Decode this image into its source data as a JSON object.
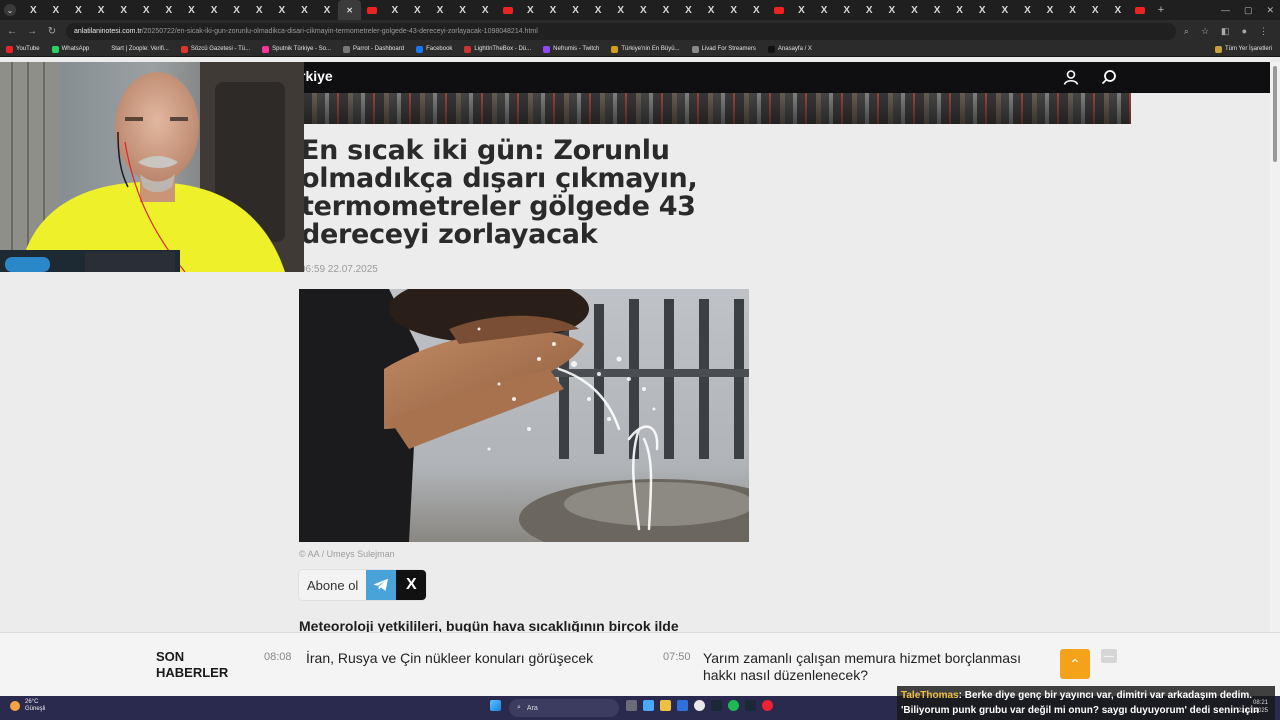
{
  "browser": {
    "tab_count": 50,
    "active_tab_index": 14,
    "youtube_tab_indices": [
      15,
      21,
      33,
      49,
      50,
      51
    ],
    "tab_close_glyph": "✕",
    "x_tab_glyph": "X",
    "newtab_glyph": "+",
    "url_host": "anlatilaninotesi.com.tr",
    "url_path": "/20250722/en-sicak-iki-gun-zorunlu-olmadikca-disari-cikmayin-termometreler-golgede-43-dereceyi-zorlayacak-1098048214.html",
    "bookmarks": [
      {
        "label": "YouTube",
        "color": "#e22"
      },
      {
        "label": "WhatsApp",
        "color": "#25d366"
      },
      {
        "label": "Start | Zoople: Verifi...",
        "color": "#2b2b2b"
      },
      {
        "label": "Sözcü Gazetesi - Tü...",
        "color": "#d33"
      },
      {
        "label": "Sputnik Türkiye - So...",
        "color": "#f39"
      },
      {
        "label": "Parrot - Dashboard",
        "color": "#777"
      },
      {
        "label": "Facebook",
        "color": "#1877f2"
      },
      {
        "label": "LightInTheBox - Dü...",
        "color": "#c33"
      },
      {
        "label": "Nefrumis - Twitch",
        "color": "#9146ff"
      },
      {
        "label": "Türkiye'nin En Büyü...",
        "color": "#d4a017"
      },
      {
        "label": "Livad For Streamers",
        "color": "#888"
      },
      {
        "label": "Anasayfa / X",
        "color": "#111"
      }
    ],
    "bookmarks_all": "Tüm Yer İşaretleri"
  },
  "site": {
    "logo": "rkiye"
  },
  "article": {
    "headline": "En sıcak iki gün: Zorunlu olmadıkça dışarı çıkmayın, termometreler gölgede 43 dereceyi zorlayacak",
    "timestamp": "06:59 22.07.2025",
    "caption": "© AA / Umeys Sulejman",
    "subscribe_label": "Abone ol",
    "x_glyph": "X",
    "lead": "Meteoroloji yetkilileri, bugün hava sıcaklığının birçok ilde"
  },
  "ticker": {
    "title": "SON HABERLER",
    "items": [
      {
        "time": "08:08",
        "text": "İran, Rusya ve Çin nükleer konuları görüşecek"
      },
      {
        "time": "07:50",
        "text": "Yarım zamanlı çalışan memura hizmet borçlanması hakkı nasıl düzenlenecek?"
      }
    ],
    "up_glyph": "⌃",
    "collapse_glyph": "—"
  },
  "chat": {
    "user": "TaleThomas",
    "text": ": Berke diye genç bir yayıncı var, dimitri var arkadaşım dedim. 'Biliyorum punk grubu var değil mi onun? saygı duyuyorum' dedi senin için"
  },
  "taskbar": {
    "temp": "26°C",
    "condition": "Güneşli",
    "search_placeholder": "Ara",
    "time": "08:21",
    "date": "22.07.2025"
  },
  "icons": {
    "user": "user-icon",
    "search": "search-icon",
    "telegram": "telegram-icon"
  }
}
